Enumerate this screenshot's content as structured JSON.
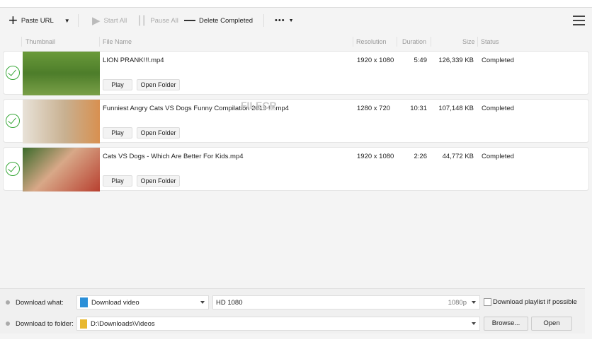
{
  "toolbar": {
    "paste_url": "Paste URL",
    "start_all": "Start All",
    "pause_all": "Pause All",
    "delete_completed": "Delete Completed",
    "more": "•••"
  },
  "columns": {
    "thumbnail": "Thumbnail",
    "file_name": "File Name",
    "resolution": "Resolution",
    "duration": "Duration",
    "size": "Size",
    "status": "Status"
  },
  "rows": [
    {
      "file_name": "LION PRANK!!!.mp4",
      "resolution": "1920 x 1080",
      "duration": "5:49",
      "size": "126,339 KB",
      "status": "Completed",
      "play": "Play",
      "open_folder": "Open Folder"
    },
    {
      "file_name": "Funniest Angry Cats VS Dogs Funny Compilation 2019 !!!.mp4",
      "resolution": "1280 x 720",
      "duration": "10:31",
      "size": "107,148 KB",
      "status": "Completed",
      "play": "Play",
      "open_folder": "Open Folder"
    },
    {
      "file_name": "Cats VS Dogs - Which Are Better For Kids.mp4",
      "resolution": "1920 x 1080",
      "duration": "2:26",
      "size": "44,772 KB",
      "status": "Completed",
      "play": "Play",
      "open_folder": "Open Folder"
    }
  ],
  "watermark": {
    "brand": "FILECR",
    ".com": ".com"
  },
  "bottom": {
    "download_what_label": "Download what:",
    "download_what_value": "Download video",
    "quality_value": "HD 1080",
    "quality_tag": "1080p",
    "playlist_label": "Download playlist if possible",
    "folder_label": "Download to folder:",
    "folder_value": "D:\\Downloads\\Videos",
    "browse": "Browse...",
    "open": "Open"
  },
  "colors": {
    "completed_green": "#3aa83a"
  }
}
